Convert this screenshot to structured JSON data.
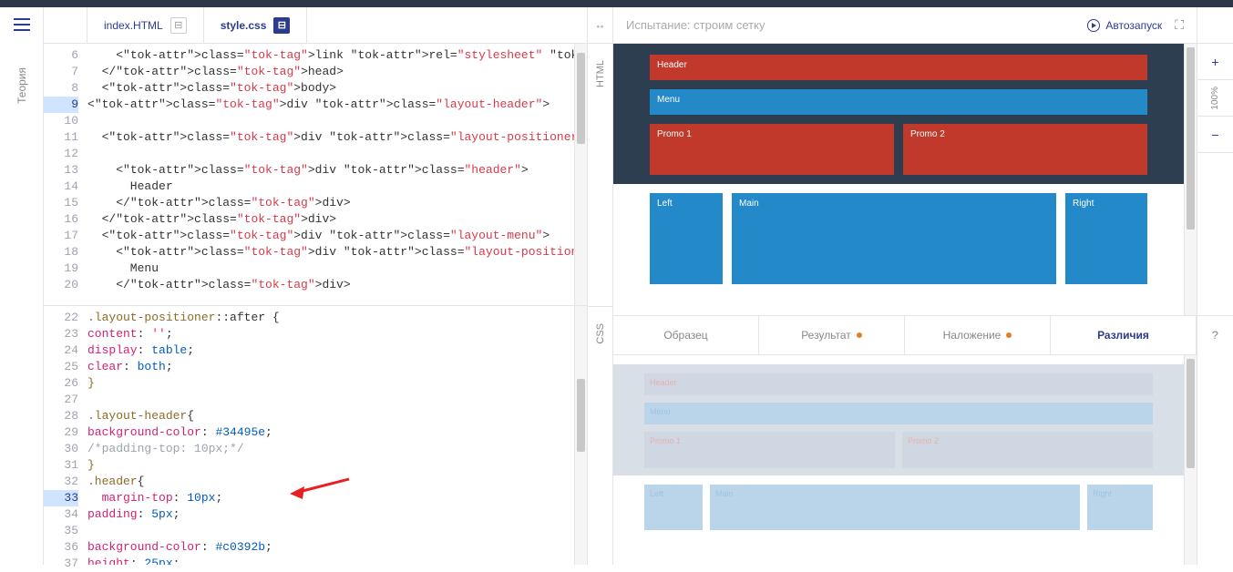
{
  "left_rail": {
    "theory": "Теория"
  },
  "tabs": {
    "html": "index.HTML",
    "css": "style.css"
  },
  "html_lang": "HTML",
  "css_lang": "CSS",
  "code_html": {
    "start": 6,
    "highlight": 9,
    "lines": [
      "    <link rel=\"stylesheet\" href=\"style.css\">",
      "  </head>",
      "  <body>",
      "<div class=\"layout-header\">",
      "",
      "  <div class=\"layout-positioner\">",
      "",
      "    <div class=\"header\">",
      "      Header",
      "    </div>",
      "  </div>",
      "  <div class=\"layout-menu\">",
      "    <div class=\"layout-positioner\">",
      "      Menu",
      "    </div>"
    ]
  },
  "code_css": {
    "start": 22,
    "highlight": 33,
    "lines": [
      ".layout-positioner::after {",
      "content: '';",
      "display: table;",
      "clear: both;",
      "}",
      "",
      ".layout-header{",
      "background-color: #34495e;",
      "/*padding-top: 10px;*/",
      "}",
      ".header{",
      "  margin-top: 10px;",
      "padding: 5px;",
      "",
      "background-color: #c0392b;",
      "height: 25px;"
    ]
  },
  "right": {
    "title": "Испытание: строим сетку",
    "autoplay": "Автозапуск"
  },
  "preview": {
    "header": "Header",
    "menu": "Menu",
    "promo1": "Promo 1",
    "promo2": "Promo 2",
    "left": "Left",
    "main": "Main",
    "right": "Right"
  },
  "result_tabs": {
    "sample": "Образец",
    "result": "Результат",
    "overlay": "Наложение",
    "diff": "Различия"
  },
  "zoom": {
    "plus": "+",
    "minus": "−",
    "pct": "100%"
  },
  "help": "?"
}
